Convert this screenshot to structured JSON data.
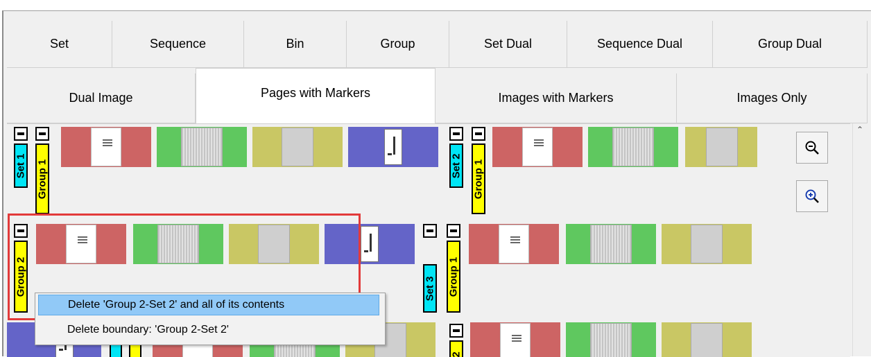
{
  "tabs": {
    "row1": [
      "Set",
      "Sequence",
      "Bin",
      "Group",
      "Set Dual",
      "Sequence Dual",
      "Group Dual"
    ],
    "row2": [
      "Dual Image",
      "Pages with Markers",
      "Images with Markers",
      "Images Only"
    ],
    "active": "Pages with Markers"
  },
  "markers": {
    "set1": "Set 1",
    "group1a": "Group 1",
    "set2": "Set 2",
    "group1b": "Group 1",
    "group2": "Group 2",
    "set3": "Set 3",
    "group1c": "Group 1",
    "partial2": "2"
  },
  "context_menu": {
    "items": [
      "Delete 'Group 2-Set 2' and all of its contents",
      "Delete boundary: 'Group 2-Set 2'"
    ]
  },
  "icons": {
    "zoom_out": "zoom-out-icon",
    "zoom_in": "zoom-in-icon",
    "scroll_up": "chevron-up-icon"
  },
  "colors": {
    "red": "#cd6464",
    "green": "#5fc85f",
    "olive": "#c9c764",
    "blue": "#6464c8",
    "set_marker": "#00e5f5",
    "group_marker": "#ffff00",
    "highlight": "#e23a3a",
    "menu_highlight": "#91c9f7"
  }
}
